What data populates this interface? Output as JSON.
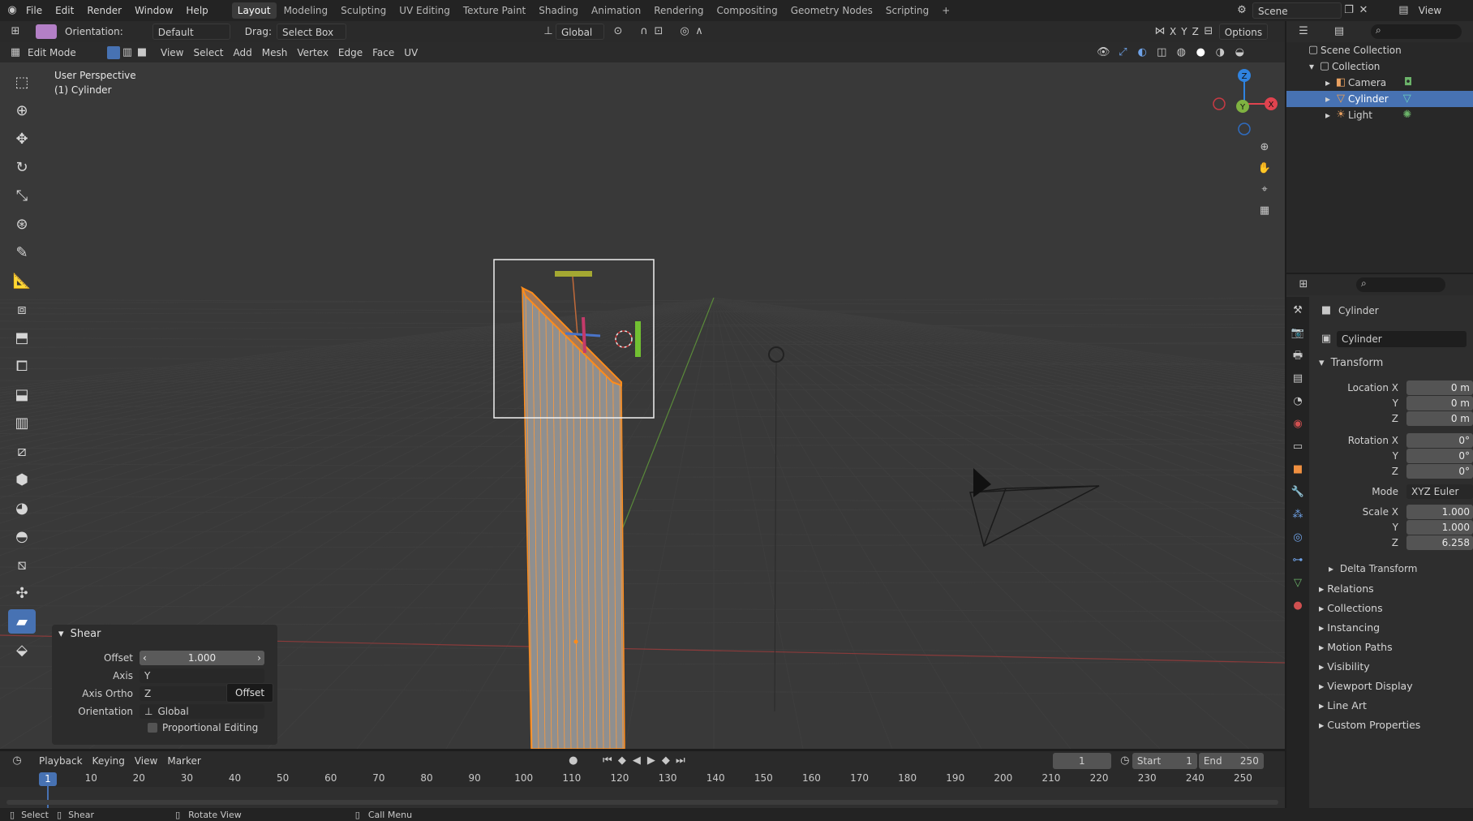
{
  "topbar": {
    "menus": [
      "File",
      "Edit",
      "Render",
      "Window",
      "Help"
    ],
    "workspaces": [
      "Layout",
      "Modeling",
      "Sculpting",
      "UV Editing",
      "Texture Paint",
      "Shading",
      "Animation",
      "Rendering",
      "Compositing",
      "Geometry Nodes",
      "Scripting"
    ],
    "active_workspace": "Layout",
    "scene": "Scene",
    "view_layer": "View Layer"
  },
  "tool_header": {
    "orientation_label": "Orientation:",
    "orientation_value": "Default",
    "drag_label": "Drag:",
    "drag_value": "Select Box",
    "transform_orientation": "Global",
    "axes": [
      "X",
      "Y",
      "Z"
    ],
    "options": "Options"
  },
  "viewport_header": {
    "mode": "Edit Mode",
    "menus": [
      "View",
      "Select",
      "Add",
      "Mesh",
      "Vertex",
      "Edge",
      "Face",
      "UV"
    ]
  },
  "viewport": {
    "view_name": "User Perspective",
    "object_name": "(1) Cylinder",
    "gizmo_axes": {
      "x": "X",
      "y": "Y",
      "z": "Z"
    }
  },
  "operator_panel": {
    "title": "Shear",
    "offset_label": "Offset",
    "offset_value": "1.000",
    "axis_label": "Axis",
    "axis_value": "Y",
    "axis_ortho_label": "Axis Ortho",
    "axis_ortho_value": "Z",
    "orientation_label": "Orientation",
    "orientation_value": "Global",
    "proportional_label": "Proportional Editing",
    "tooltip": "Offset"
  },
  "outliner": {
    "root": "Scene Collection",
    "collection": "Collection",
    "items": [
      {
        "label": "Camera",
        "selected": false
      },
      {
        "label": "Cylinder",
        "selected": true
      },
      {
        "label": "Light",
        "selected": false
      }
    ]
  },
  "properties": {
    "object_title": "Cylinder",
    "object_name_field": "Cylinder",
    "transform_header": "Transform",
    "location_label": "Location X",
    "location": [
      "0 m",
      "0 m",
      "0 m"
    ],
    "rotation_label": "Rotation X",
    "rotation": [
      "0°",
      "0°",
      "0°"
    ],
    "mode_label": "Mode",
    "mode_value": "XYZ Euler",
    "scale_label": "Scale X",
    "scale": [
      "1.000",
      "1.000",
      "6.258"
    ],
    "y_label": "Y",
    "z_label": "Z",
    "delta": "Delta Transform",
    "sections": [
      "Relations",
      "Collections",
      "Instancing",
      "Motion Paths",
      "Visibility",
      "Viewport Display",
      "Line Art",
      "Custom Properties"
    ]
  },
  "timeline": {
    "menus": [
      "Playback",
      "Keying",
      "View",
      "Marker"
    ],
    "current_frame": "1",
    "start_label": "Start",
    "start_value": "1",
    "end_label": "End",
    "end_value": "250",
    "ticks": [
      "10",
      "20",
      "30",
      "40",
      "50",
      "60",
      "70",
      "80",
      "90",
      "100",
      "110",
      "120",
      "130",
      "140",
      "150",
      "160",
      "170",
      "180",
      "190",
      "200",
      "210",
      "220",
      "230",
      "240",
      "250"
    ],
    "frame_indicator": "1"
  },
  "statusbar": {
    "items": [
      "Select",
      "Shear",
      "Rotate View",
      "Call Menu"
    ]
  },
  "colors": {
    "accent": "#4772b3",
    "selection_orange": "#ff8c1a",
    "axis_x": "#e0434f",
    "axis_y": "#7fb241",
    "axis_z": "#2f83e0"
  }
}
